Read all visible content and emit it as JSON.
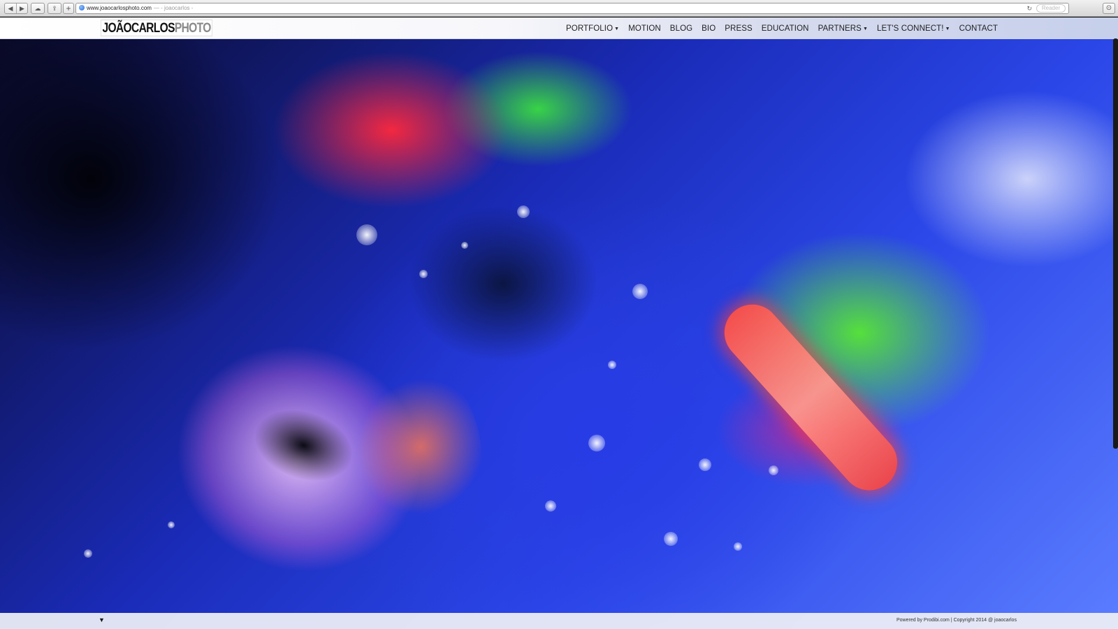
{
  "browser": {
    "url": "www.joaocarlosphoto.com",
    "page_title": "— - joaocarlos -",
    "reader_label": "Reader"
  },
  "site": {
    "logo_bold": "JOÃOCARLOS",
    "logo_light": "PHOTO",
    "nav": [
      {
        "label": "PORTFOLIO",
        "dropdown": true
      },
      {
        "label": "MOTION",
        "dropdown": false
      },
      {
        "label": "BLOG",
        "dropdown": false
      },
      {
        "label": "BIO",
        "dropdown": false
      },
      {
        "label": "PRESS",
        "dropdown": false
      },
      {
        "label": "EDUCATION",
        "dropdown": false
      },
      {
        "label": "PARTNERS",
        "dropdown": true
      },
      {
        "label": "LET'S CONNECT!",
        "dropdown": true
      },
      {
        "label": "CONTACT",
        "dropdown": false
      }
    ]
  },
  "hero": {
    "image_icon": "neon-face-photo"
  },
  "footer": {
    "scroll_arrow": "▼",
    "copyright": "Powered by Prodibi.com | Copyright 2014 @ joaocarlos"
  }
}
